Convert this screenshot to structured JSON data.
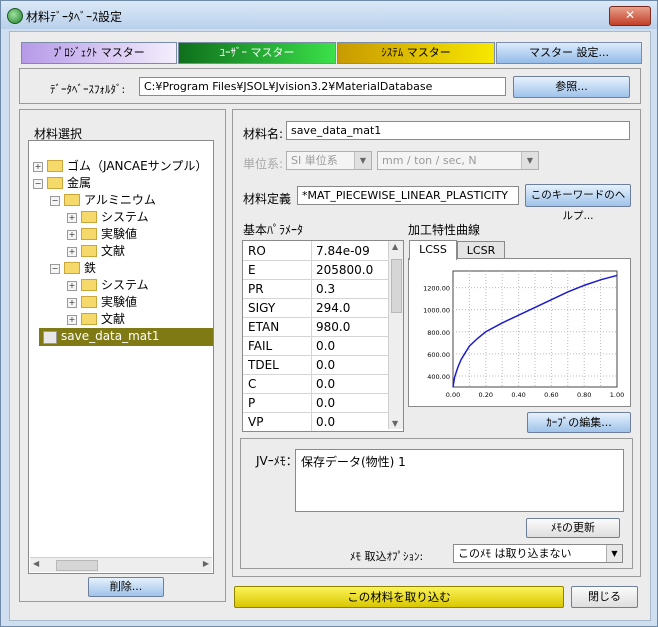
{
  "window": {
    "title": "材料ﾃﾞｰﾀﾍﾞｰｽ設定",
    "close_label": "✕"
  },
  "top_tabs": [
    {
      "label": "ﾌﾟﾛｼﾞｪｸﾄ マスター",
      "color": "#c8b4f0"
    },
    {
      "label": "ﾕｰｻﾞｰ マスター",
      "color": "#2fae3c"
    },
    {
      "label": "ｼｽﾃﾑ マスター",
      "color": "#e3c200"
    },
    {
      "label": "マスター 設定...",
      "color": "#a9c8f0"
    }
  ],
  "db_folder": {
    "label": "ﾃﾞｰﾀﾍﾞｰｽﾌｫﾙﾀﾞ:",
    "value": "C:¥Program Files¥JSOL¥Jvision3.2¥MaterialDatabase",
    "browse_label": "参照..."
  },
  "material_select": {
    "heading": "材料選択",
    "tree": [
      {
        "label": "ゴム（JANCAEサンプル）",
        "level": 0,
        "expander": "+"
      },
      {
        "label": "金属",
        "level": 0,
        "expander": "−"
      },
      {
        "label": "アルミニウム",
        "level": 1,
        "expander": "−"
      },
      {
        "label": "システム",
        "level": 2,
        "expander": "+"
      },
      {
        "label": "実験値",
        "level": 2,
        "expander": "+"
      },
      {
        "label": "文献",
        "level": 2,
        "expander": "+"
      },
      {
        "label": "鉄",
        "level": 1,
        "expander": "−"
      },
      {
        "label": "システム",
        "level": 2,
        "expander": "+"
      },
      {
        "label": "実験値",
        "level": 2,
        "expander": "+"
      },
      {
        "label": "文献",
        "level": 2,
        "expander": "+"
      }
    ],
    "selected_item": "save_data_mat1",
    "delete_label": "削除..."
  },
  "material": {
    "name_label": "材料名:",
    "name_value": "save_data_mat1",
    "unit_label": "単位系:",
    "unit_system": "SI 単位系",
    "unit_detail": "mm / ton / sec, N",
    "definition_label": "材料定義",
    "definition_value": "*MAT_PIECEWISE_LINEAR_PLASTICITY",
    "keyword_help_label": "このキーワードのヘルプ..."
  },
  "params": {
    "heading": "基本ﾊﾟﾗﾒｰﾀ",
    "rows": [
      {
        "name": "RO",
        "value": "7.84e-09"
      },
      {
        "name": "E",
        "value": "205800.0"
      },
      {
        "name": "PR",
        "value": "0.3"
      },
      {
        "name": "SIGY",
        "value": "294.0"
      },
      {
        "name": "ETAN",
        "value": "980.0"
      },
      {
        "name": "FAIL",
        "value": "0.0"
      },
      {
        "name": "TDEL",
        "value": "0.0"
      },
      {
        "name": "C",
        "value": "0.0"
      },
      {
        "name": "P",
        "value": "0.0"
      },
      {
        "name": "VP",
        "value": "0.0"
      }
    ]
  },
  "curve": {
    "heading": "加工特性曲線",
    "tabs": [
      "LCSS",
      "LCSR"
    ],
    "active_tab": "LCSS",
    "edit_label": "ｶｰﾌﾞの編集..."
  },
  "chart_data": {
    "type": "line",
    "x_ticks": [
      "0.00",
      "0.20",
      "0.40",
      "0.60",
      "0.80",
      "1.00"
    ],
    "y_ticks": [
      "400.00",
      "600.00",
      "800.00",
      "1000.00",
      "1200.00"
    ],
    "xlim": [
      0,
      1
    ],
    "ylim": [
      300,
      1350
    ],
    "grid": true,
    "line_color": "#1c1ccc",
    "series": [
      {
        "x": [
          0,
          0.01,
          0.03,
          0.05,
          0.1,
          0.15,
          0.2,
          0.3,
          0.4,
          0.5,
          0.6,
          0.7,
          0.8,
          0.9,
          1.0
        ],
        "y": [
          300,
          390,
          480,
          550,
          670,
          740,
          800,
          880,
          950,
          1020,
          1090,
          1160,
          1220,
          1270,
          1310
        ]
      }
    ]
  },
  "memo": {
    "label": "JVｰﾒﾓ：",
    "text": "保存データ(物性) 1",
    "update_label": "ﾒﾓの更新",
    "option_label": "ﾒﾓ 取込ｵﾌﾟｼｮﾝ:",
    "option_value": "このﾒﾓ は取り込まない"
  },
  "footer": {
    "import_label": "この材料を取り込む",
    "close_label": "閉じる"
  }
}
